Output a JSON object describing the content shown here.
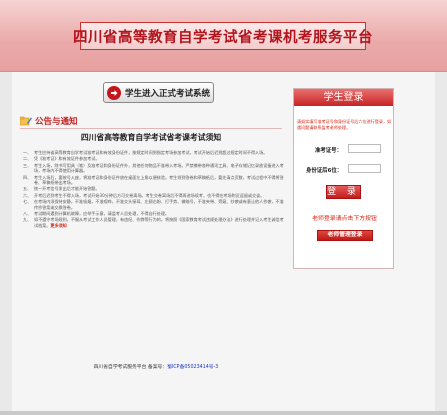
{
  "header": {
    "title": "四川省高等教育自学考试省考课机考服务平台"
  },
  "exam_button": {
    "label": "学生进入正式考试系统",
    "icon": "arrow-right-icon"
  },
  "notice": {
    "heading": "公告与通知",
    "icon": "folder-pencil-icon",
    "title": "四川省高等教育自学考试省考课考试须知",
    "rules": [
      {
        "num": "一、",
        "text": "考生应持省高等教育自学考试准考证和有效身份证件，按规定时间到指定考场参加考试，考试开始后迟到超过规定时间不得入场。"
      },
      {
        "num": "二、",
        "text": "凭《准考证》和有效证件参加考试。"
      },
      {
        "num": "三、",
        "text": "考生入场，除书写用具（笔）及准考证和身份证件外，其他任何物品不准带入考场。严禁携带各种通讯工具、电子存储记忆录放设备进入考场，考场内不得使用计算器。"
      },
      {
        "num": "四、",
        "text": "考生入场后，要按号入座，将准考证和身份证件放在桌面左上角以便核验。考生领到答卷和草稿纸后，要先清点页数，考试过程中不得将答卷、草稿纸带出考场。"
      },
      {
        "num": "五、",
        "text": "统一开考信号发出后才能开始答题。"
      },
      {
        "num": "六、",
        "text": "开考后迟到考生不得入场，考试开始30分钟后方可交卷离场。考生交卷离场后不得再进场续考，也不得在考场附近逗留或交谈。"
      },
      {
        "num": "七、",
        "text": "在考场内须保持安静，不准吸烟，不准喧哗，不准交头接耳、左顾右盼、打手势、做暗号，不准夹带、旁窥、抄袭或有意让他人抄袭，不准传抄答案或交换答卷。"
      },
      {
        "num": "八、",
        "text": "考试期间遇到计算机故障，应举手示意，请监考人员处理，不得自行处理。"
      },
      {
        "num": "九、",
        "text": "如不遵守考场规则，不服从考试工作人员管理，有违纪、作弊等行为的，将按照《国家教育考试违规处理办法》进行处理并记入考生诚信考试档案。",
        "link": "更多须知"
      }
    ]
  },
  "footer": {
    "prefix": "四川省自学考试服务平台 备案号：",
    "record": "蜀ICP备05023414号-3"
  },
  "login": {
    "title": "学生登录",
    "note": "请如实填写准考证号和身份证号后六位进行登录，如遇问题请联系监考老师处理。",
    "exam_no_label": "准考证号：",
    "id_label": "身份证后6位：",
    "submit_label": "登 录",
    "teacher_hint": "老师登录请点击下方按钮",
    "teacher_button": "老师管理登录"
  }
}
